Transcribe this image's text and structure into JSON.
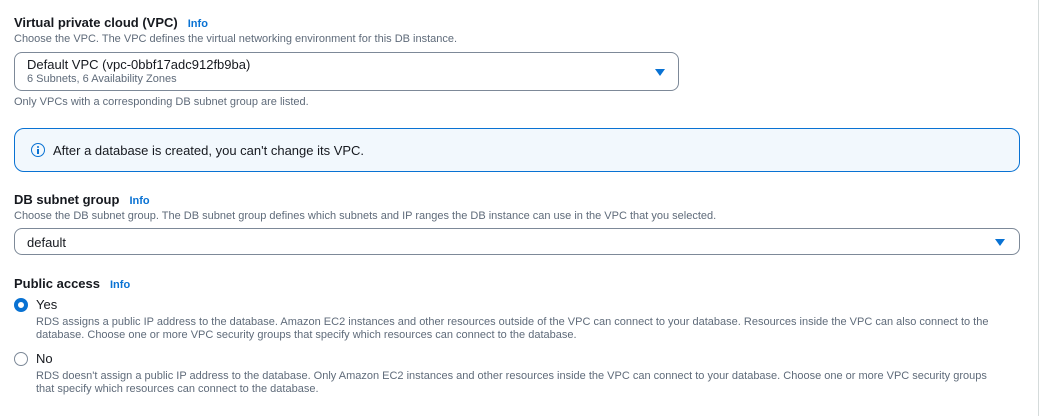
{
  "vpc": {
    "label": "Virtual private cloud (VPC)",
    "info": "Info",
    "description": "Choose the VPC. The VPC defines the virtual networking environment for this DB instance.",
    "selected_value": "Default VPC (vpc-0bbf17adc912fb9ba)",
    "selected_detail": "6 Subnets, 6 Availability Zones",
    "constraint": "Only VPCs with a corresponding DB subnet group are listed."
  },
  "alert": {
    "text": "After a database is created, you can't change its VPC.",
    "icon": "info-circle-icon",
    "color": "#0972d3"
  },
  "subnet_group": {
    "label": "DB subnet group",
    "info": "Info",
    "description": "Choose the DB subnet group. The DB subnet group defines which subnets and IP ranges the DB instance can use in the VPC that you selected.",
    "selected_value": "default"
  },
  "public_access": {
    "label": "Public access",
    "info": "Info",
    "options": [
      {
        "label": "Yes",
        "checked": true,
        "description": "RDS assigns a public IP address to the database. Amazon EC2 instances and other resources outside of the VPC can connect to your database. Resources inside the VPC can also connect to the database. Choose one or more VPC security groups that specify which resources can connect to the database."
      },
      {
        "label": "No",
        "checked": false,
        "description": "RDS doesn't assign a public IP address to the database. Only Amazon EC2 instances and other resources inside the VPC can connect to your database. Choose one or more VPC security groups that specify which resources can connect to the database."
      }
    ]
  },
  "colors": {
    "accent": "#0972d3",
    "text": "#16191f",
    "secondary_text": "#5f6b7a",
    "alert_bg": "#f2f8fd"
  }
}
